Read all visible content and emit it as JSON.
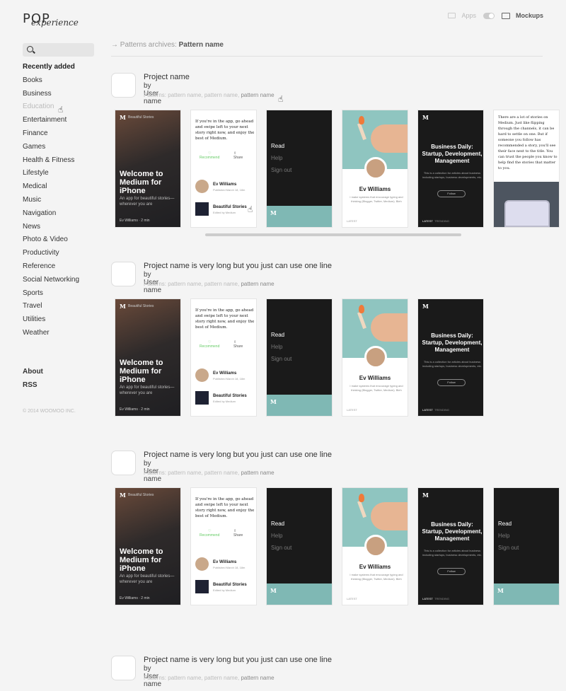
{
  "header": {
    "logo_main": "POP",
    "logo_script": "experience",
    "apps_label": "Apps",
    "mockups_label": "Mockups"
  },
  "sidebar": {
    "items": [
      {
        "label": "Recently added"
      },
      {
        "label": "Books"
      },
      {
        "label": "Business"
      },
      {
        "label": "Education"
      },
      {
        "label": "Entertainment"
      },
      {
        "label": "Finance"
      },
      {
        "label": "Games"
      },
      {
        "label": "Health & Fitness"
      },
      {
        "label": "Lifestyle"
      },
      {
        "label": "Medical"
      },
      {
        "label": "Music"
      },
      {
        "label": "Navigation"
      },
      {
        "label": "News"
      },
      {
        "label": "Photo & Video"
      },
      {
        "label": "Productivity"
      },
      {
        "label": "Reference"
      },
      {
        "label": "Social Networking"
      },
      {
        "label": "Sports"
      },
      {
        "label": "Travel"
      },
      {
        "label": "Utilities"
      },
      {
        "label": "Weather"
      }
    ],
    "about": "About",
    "rss": "RSS",
    "copyright": "© 2014 WOOMOO INC."
  },
  "breadcrumb": {
    "prefix": "Patterns archives:",
    "current": "Pattern name"
  },
  "projects": [
    {
      "title": "Project name",
      "by": "by User name",
      "patterns_label": "Patterns:",
      "p1": "pattern name,",
      "p2": "pattern name,",
      "p3": "pattern name"
    },
    {
      "title": "Project name is very long but you just can use one line",
      "by": "by User name",
      "patterns_label": "Patterns:",
      "p1": "pattern name,",
      "p2": "pattern name,",
      "p3": "pattern name"
    },
    {
      "title": "Project name is very long but you just can use one line",
      "by": "by User name",
      "patterns_label": "Patterns:",
      "p1": "pattern name,",
      "p2": "pattern name,",
      "p3": "pattern name"
    },
    {
      "title": "Project name is very long but you just can use one line",
      "by": "by User name",
      "patterns_label": "Patterns:",
      "p1": "pattern name,",
      "p2": "pattern name,",
      "p3": "pattern name"
    }
  ],
  "screens": {
    "welcome": {
      "m": "M",
      "brand": "Beautiful Stories",
      "headline": "Welcome to Medium for iPhone",
      "sub": "An app for beautiful stories—wherever you are",
      "author": "Ev Williams",
      "time": "2 min"
    },
    "article": {
      "text": "If you're in the app, go ahead and swipe left to your next story right now, and enjoy the best of Medium.",
      "recommend": "Recommend",
      "share": "Share",
      "author": "Ev Williams",
      "published": "Published March 18, 18m",
      "story": "Beautiful Stories",
      "edited": "Edited by Medium"
    },
    "menu": {
      "read": "Read",
      "help": "Help",
      "signout": "Sign out",
      "m": "M"
    },
    "profile": {
      "name": "Ev Williams",
      "bio": "I make systems that encourage typing and thinking (Blogger, Twitter, Medium). Bleh",
      "latest": "LATEST"
    },
    "business": {
      "m": "M",
      "headline": "Business Daily: Startup, Development, Management",
      "desc": "This is a collection for articles about business including startups, business developments, etc.",
      "follow": "Follow",
      "latest": "LATEST",
      "trending": "TRENDING"
    },
    "text": {
      "body": "There are a lot of stories on Medium. Just like flipping through the channels, it can be hard to settle on one. But if someone you follow has recommended a story, you'll see their face next to the title. You can trust the people you know to help find the stories that matter to you."
    }
  }
}
